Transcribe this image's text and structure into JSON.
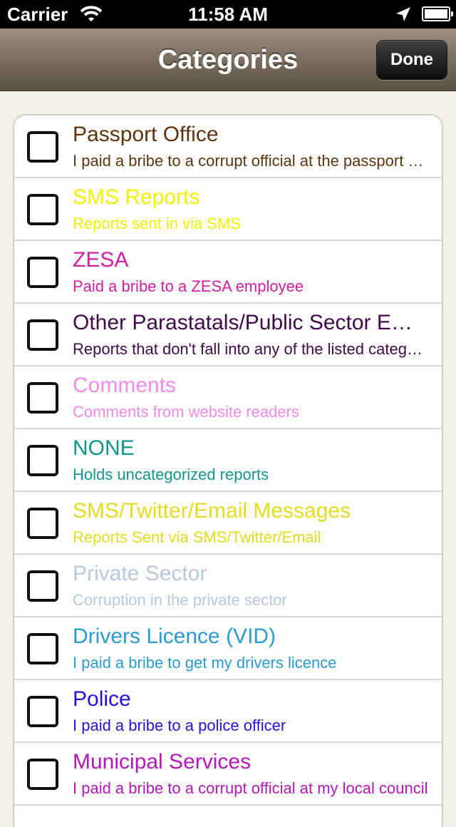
{
  "status_bar": {
    "carrier": "Carrier",
    "time": "11:58 AM",
    "icons": [
      "wifi-icon",
      "location-arrow-icon",
      "battery-icon"
    ]
  },
  "nav": {
    "title": "Categories",
    "done_label": "Done"
  },
  "categories": [
    {
      "title": "Passport Office",
      "subtitle": "I paid a bribe to a corrupt official at the passport office",
      "color": "#5c3510"
    },
    {
      "title": "SMS Reports",
      "subtitle": "Reports sent in via SMS",
      "color": "#f0f000"
    },
    {
      "title": "ZESA",
      "subtitle": "Paid a bribe to a ZESA employee",
      "color": "#d21fa0"
    },
    {
      "title": "Other Parastatals/Public Sector Employees",
      "subtitle": "Reports that don't fall into any of the listed categories",
      "color": "#3f0a4a"
    },
    {
      "title": "Comments",
      "subtitle": "Comments from website readers",
      "color": "#f08ae8"
    },
    {
      "title": "NONE",
      "subtitle": "Holds uncategorized reports",
      "color": "#12968a"
    },
    {
      "title": "SMS/Twitter/Email Messages",
      "subtitle": "Reports Sent via SMS/Twitter/Email",
      "color": "#e2dc20"
    },
    {
      "title": "Private Sector",
      "subtitle": "Corruption in the private sector",
      "color": "#b7c8dc"
    },
    {
      "title": "Drivers Licence (VID)",
      "subtitle": "I paid a bribe to get my drivers licence",
      "color": "#2a9ad0"
    },
    {
      "title": "Police",
      "subtitle": "I paid a bribe to a police officer",
      "color": "#2a10e0"
    },
    {
      "title": "Municipal Services",
      "subtitle": "I paid a bribe to a corrupt official at my local council",
      "color": "#b418b8"
    }
  ]
}
